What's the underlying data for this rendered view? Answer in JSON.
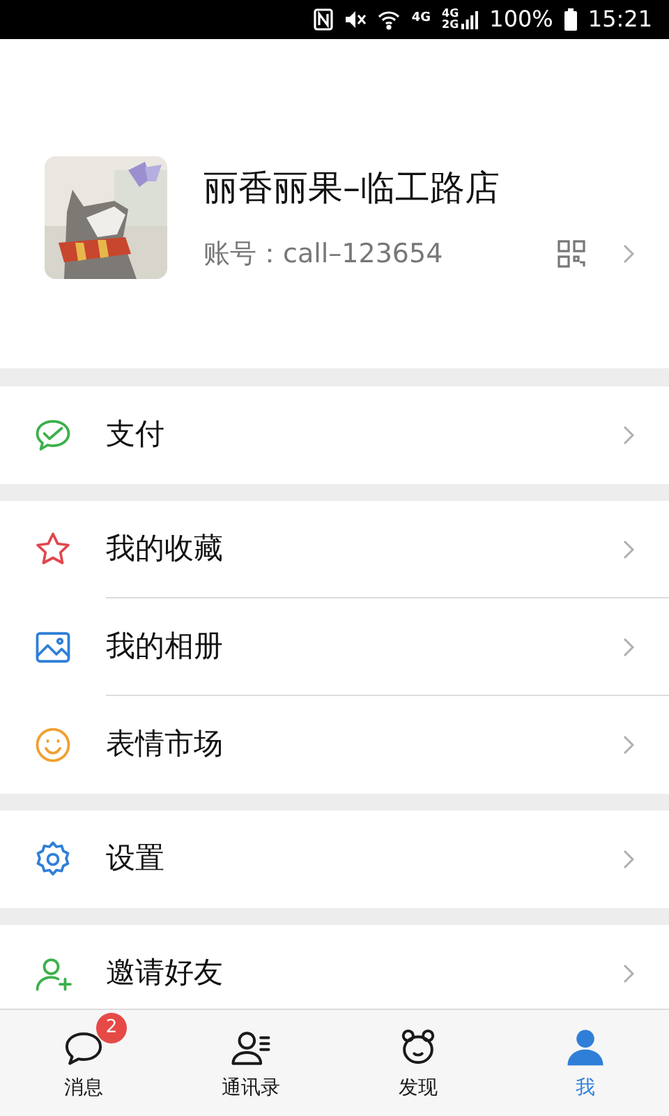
{
  "status_bar": {
    "network_1": "4G",
    "network_2": "4G",
    "network_3": "2G",
    "battery": "100%",
    "time": "15:21"
  },
  "profile": {
    "name": "丽香丽果–临工路店",
    "account": "账号：call–123654"
  },
  "menu_groups": [
    {
      "items": [
        {
          "kind": "pay",
          "label": "支付"
        }
      ]
    },
    {
      "items": [
        {
          "kind": "favorites",
          "label": "我的收藏"
        },
        {
          "kind": "album",
          "label": "我的相册"
        },
        {
          "kind": "emoji",
          "label": "表情市场"
        }
      ]
    },
    {
      "items": [
        {
          "kind": "settings",
          "label": "设置"
        }
      ]
    },
    {
      "items": [
        {
          "kind": "invite",
          "label": "邀请好友"
        }
      ]
    }
  ],
  "tab_bar": [
    {
      "kind": "chat",
      "label": "消息",
      "badge": "2",
      "selected": false
    },
    {
      "kind": "contacts",
      "label": "通讯录",
      "selected": false
    },
    {
      "kind": "discover",
      "label": "发现",
      "selected": false
    },
    {
      "kind": "me",
      "label": "我",
      "selected": true
    }
  ]
}
